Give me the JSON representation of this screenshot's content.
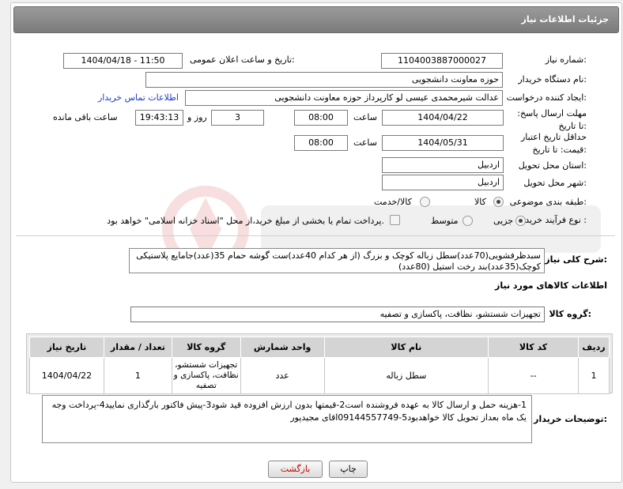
{
  "header": {
    "title": "جزئیات اطلاعات نیاز"
  },
  "fields": {
    "need_number_label": "شماره نیاز:",
    "need_number": "1104003887000027",
    "announce_label": "تاریخ و ساعت اعلان عمومی:",
    "announce_value": "1404/04/18 - 11:50",
    "buyer_org_label": "نام دستگاه خریدار:",
    "buyer_org": "حوزه معاونت دانشجویی",
    "creator_label": "ایجاد کننده درخواست:",
    "creator": "عدالت شیرمحمدی عیسی لو کارپرداز حوزه معاونت دانشجویی",
    "contact_link": "اطلاعات تماس خریدار",
    "reply_deadline_label": "مهلت ارسال پاسخ: تا تاریخ:",
    "reply_date": "1404/04/22",
    "time_label": "ساعت",
    "reply_time": "08:00",
    "days": "3",
    "days_label": "روز و",
    "remaining_time": "19:43:13",
    "remaining_label": "ساعت باقی مانده",
    "price_validity_label": "حداقل تاریخ اعتبار قیمت: تا تاریخ:",
    "validity_date": "1404/05/31",
    "validity_time": "08:00",
    "province_label": "استان محل تحویل:",
    "province": "اردبیل",
    "city_label": "شهر محل تحویل:",
    "city": "اردبیل",
    "category_label": "طبقه بندی موضوعی:",
    "category_goods": "کالا",
    "category_service": "کالا/خدمت",
    "process_label": "نوع فرآیند خرید :",
    "process_minor": "جزیی",
    "process_medium": "متوسط",
    "payment_note": "پرداخت تمام یا بخشی از مبلغ خرید،از محل \"اسناد خزانه اسلامی\" خواهد بود."
  },
  "description": {
    "label": "شرح کلی نیاز:",
    "text": "سبدظرفشویی(70عدد)سطل زباله کوچک و بزرگ (از هر کدام 40عدد)ست گوشه حمام 35(عدد)جامایع پلاستیکی کوچک(35عدد)بند رخت استیل (80عدد)"
  },
  "goods_info": {
    "title": "اطلاعات کالاهای مورد نیاز",
    "group_label": "گروه کالا:",
    "group_value": "تجهیزات شستشو، نظافت، پاکسازی و تصفیه"
  },
  "table": {
    "headers": [
      "ردیف",
      "کد کالا",
      "نام کالا",
      "واحد شمارش",
      "گروه کالا",
      "تعداد / مقدار",
      "تاریخ نیاز"
    ],
    "rows": [
      {
        "row": "1",
        "code": "--",
        "name": "سطل زباله",
        "unit": "عدد",
        "group": "تجهیزات شستشو، نظافت، پاکسازی و تصفیه",
        "qty": "1",
        "date": "1404/04/22"
      }
    ]
  },
  "buyer_notes": {
    "label": "توضیحات خریدار:",
    "text": "1-هزینه حمل و ارسال کالا به عهده فروشنده است2-قیمتها بدون ارزش افزوده قید شود3-پیش فاکتور بارگذاری نمایید4-پرداخت وجه یک ماه بعداز تحویل کالا خواهدبود5-09144557749اقای مجیدپور"
  },
  "buttons": {
    "print": "چاپ",
    "back": "بازگشت"
  },
  "colors": {
    "header_bg": "#8a8a8a",
    "link": "#1a3cc8",
    "back_text": "#c00000"
  }
}
